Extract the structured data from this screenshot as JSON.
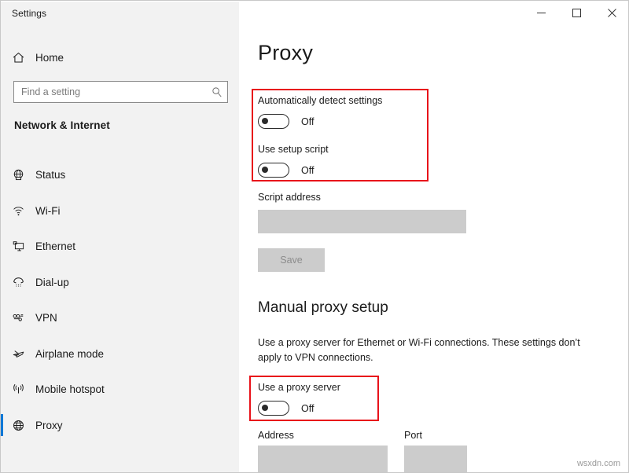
{
  "window": {
    "title": "Settings",
    "controls": [
      {
        "name": "minimize",
        "label": "–"
      },
      {
        "name": "maximize",
        "label": "□"
      },
      {
        "name": "close",
        "label": "×"
      }
    ]
  },
  "sidebar": {
    "home_label": "Home",
    "search": {
      "placeholder": "Find a setting",
      "value": "Find a setting"
    },
    "category": "Network & Internet",
    "items": [
      {
        "label": "Status",
        "icon": "globe-status-icon",
        "selected": false
      },
      {
        "label": "Wi-Fi",
        "icon": "wifi-icon",
        "selected": false
      },
      {
        "label": "Ethernet",
        "icon": "ethernet-icon",
        "selected": false
      },
      {
        "label": "Dial-up",
        "icon": "dialup-icon",
        "selected": false
      },
      {
        "label": "VPN",
        "icon": "vpn-icon",
        "selected": false
      },
      {
        "label": "Airplane mode",
        "icon": "airplane-icon",
        "selected": false
      },
      {
        "label": "Mobile hotspot",
        "icon": "hotspot-icon",
        "selected": false
      },
      {
        "label": "Proxy",
        "icon": "globe-icon",
        "selected": true
      }
    ]
  },
  "main": {
    "page_title": "Proxy",
    "auto_detect": {
      "label": "Automatically detect settings",
      "state": "Off"
    },
    "setup_script": {
      "label": "Use setup script",
      "state": "Off"
    },
    "script_address": {
      "label": "Script address",
      "value": ""
    },
    "save_button": "Save",
    "manual_section": {
      "title": "Manual proxy setup",
      "description": "Use a proxy server for Ethernet or Wi-Fi connections. These settings don’t apply to VPN connections.",
      "use_proxy": {
        "label": "Use a proxy server",
        "state": "Off"
      },
      "address": {
        "label": "Address",
        "value": ""
      },
      "port": {
        "label": "Port",
        "value": ""
      }
    }
  },
  "annotations": {
    "highlight_color": "#e8121a",
    "accent_color": "#0078d7"
  },
  "watermark": "wsxdn.com"
}
